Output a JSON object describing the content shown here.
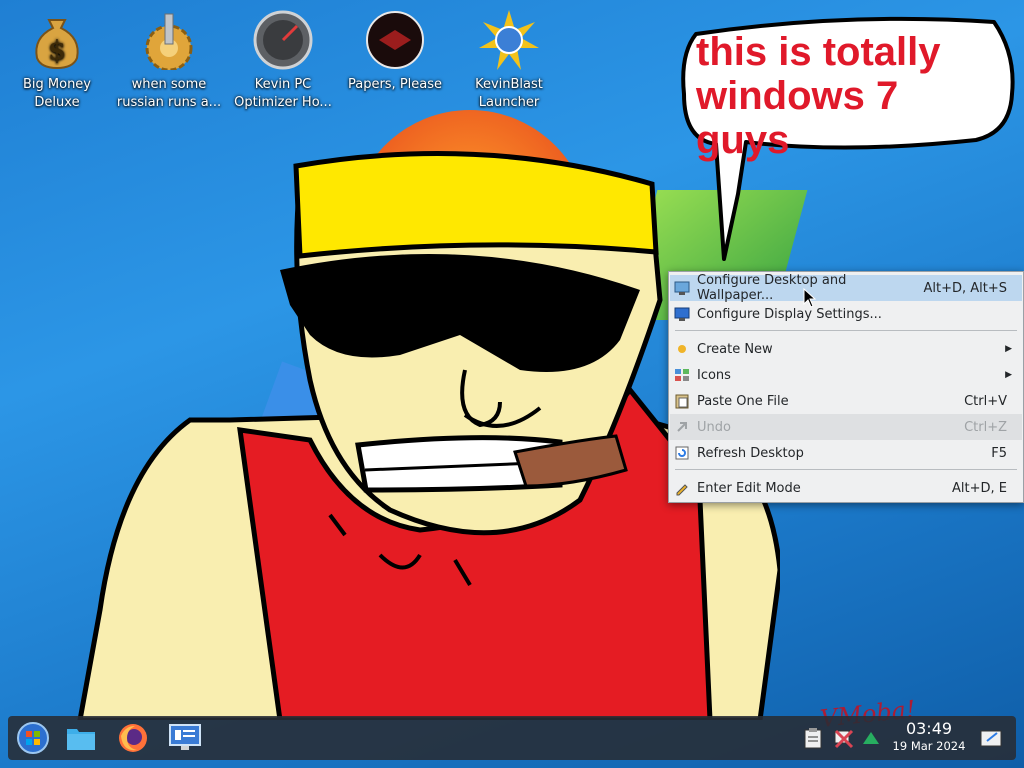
{
  "desktop": {
    "icons": [
      {
        "name": "big-money-deluxe",
        "label": "Big Money\nDeluxe"
      },
      {
        "name": "russian",
        "label": "when some\nrussian runs a..."
      },
      {
        "name": "optimizer",
        "label": "Kevin PC\nOptimizer Ho..."
      },
      {
        "name": "papers-please",
        "label": "Papers, Please"
      },
      {
        "name": "kevinblast",
        "label": "KevinBlast\nLauncher"
      }
    ],
    "speech_bubble": "this is totally windows 7 guys",
    "watermark": "VMoba!"
  },
  "context_menu": {
    "items": [
      {
        "label": "Configure Desktop and Wallpaper...",
        "shortcut": "Alt+D, Alt+S",
        "icon": "configure-desktop-icon",
        "state": "highlighted"
      },
      {
        "label": "Configure Display Settings...",
        "shortcut": "",
        "icon": "display-settings-icon",
        "state": "normal"
      },
      {
        "label": "Create New",
        "shortcut": "",
        "icon": "create-new-icon",
        "state": "submenu"
      },
      {
        "label": "Icons",
        "shortcut": "",
        "icon": "icons-icon",
        "state": "submenu"
      },
      {
        "label": "Paste One File",
        "shortcut": "Ctrl+V",
        "icon": "paste-icon",
        "state": "normal"
      },
      {
        "label": "Undo",
        "shortcut": "Ctrl+Z",
        "icon": "undo-icon",
        "state": "disabled"
      },
      {
        "label": "Refresh Desktop",
        "shortcut": "F5",
        "icon": "refresh-icon",
        "state": "normal"
      },
      {
        "label": "Enter Edit Mode",
        "shortcut": "Alt+D, E",
        "icon": "edit-mode-icon",
        "state": "normal"
      }
    ]
  },
  "taskbar": {
    "launchers": [
      "start-menu-icon",
      "file-manager-icon",
      "firefox-icon",
      "system-settings-icon"
    ],
    "tray": [
      "clipboard-icon",
      "network-disconnected-icon",
      "update-arrow-icon"
    ],
    "clock": {
      "time": "03:49",
      "date": "19 Mar 2024"
    },
    "show_desktop": "show-desktop-icon"
  },
  "colors": {
    "accent": "#3daee9",
    "menu_bg": "#eff0f1",
    "highlight": "#bdd7ef",
    "bubble_text": "#e0192a"
  }
}
